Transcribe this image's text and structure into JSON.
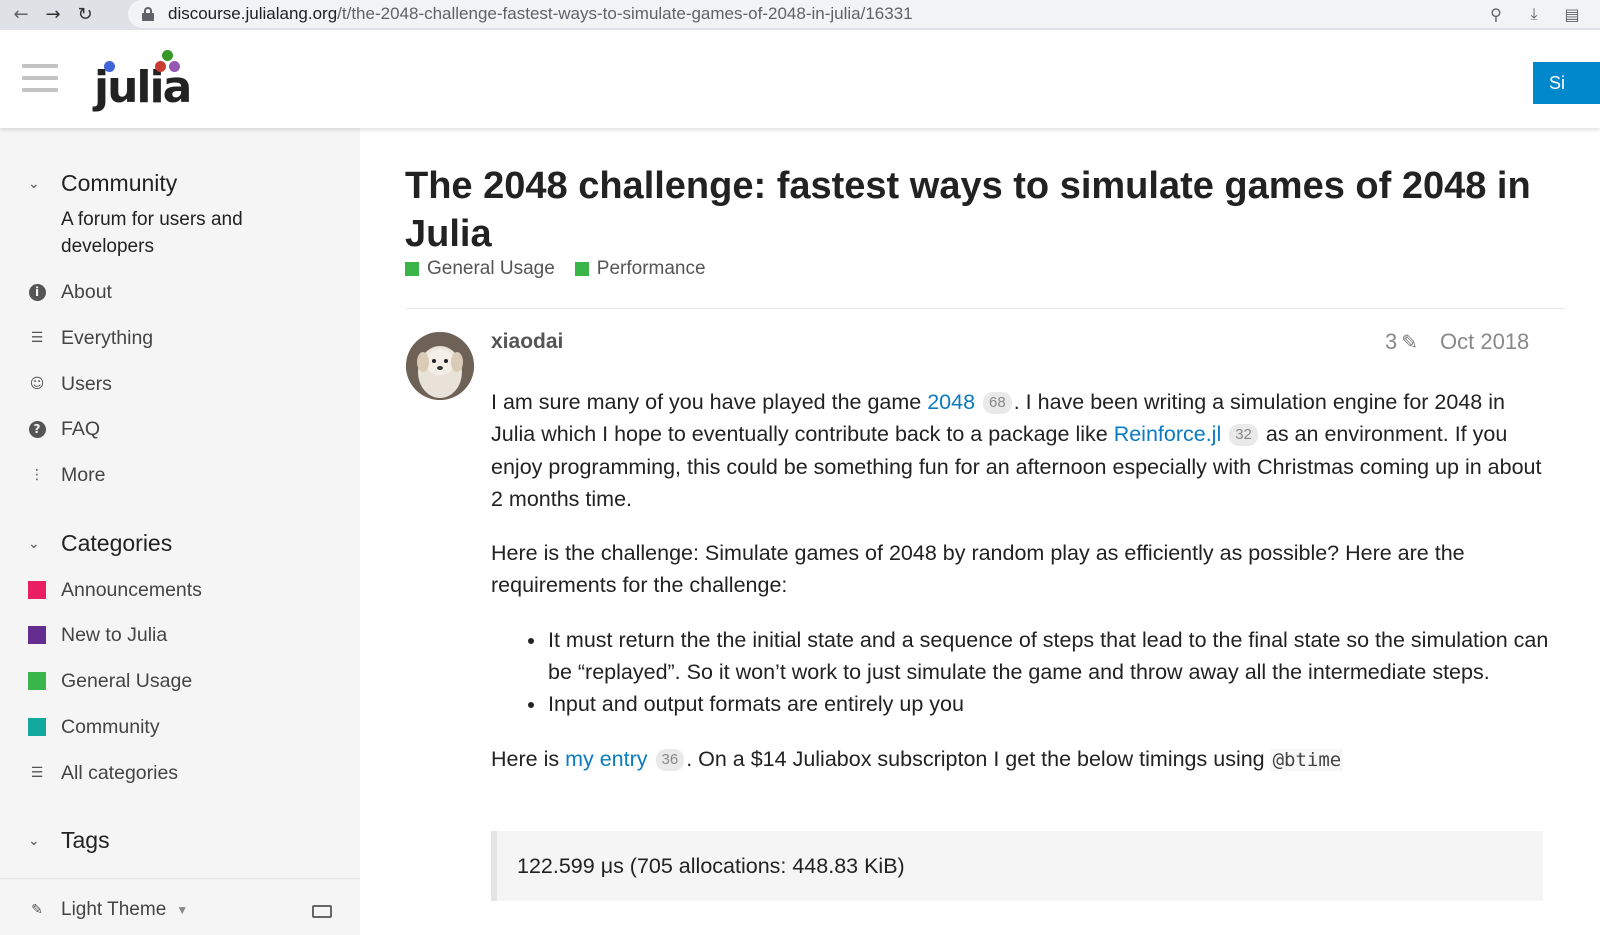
{
  "browser": {
    "domain": "discourse.julialang.org",
    "path": "/t/the-2048-challenge-fastest-ways-to-simulate-games-of-2048-in-julia/16331"
  },
  "header": {
    "logo_text": "julia",
    "signin_label": "Si",
    "accent": "#0088cc"
  },
  "sidebar": {
    "community": {
      "heading": "Community",
      "description": "A forum for users and developers",
      "items": [
        {
          "label": "About",
          "icon": "info-icon"
        },
        {
          "label": "Everything",
          "icon": "layers-icon"
        },
        {
          "label": "Users",
          "icon": "users-icon"
        },
        {
          "label": "FAQ",
          "icon": "question-icon"
        },
        {
          "label": "More",
          "icon": "ellipsis-vertical-icon"
        }
      ]
    },
    "categories": {
      "heading": "Categories",
      "items": [
        {
          "label": "Announcements",
          "color": "#e91e63"
        },
        {
          "label": "New to Julia",
          "color": "#652d90"
        },
        {
          "label": "General Usage",
          "color": "#3ab54a"
        },
        {
          "label": "Community",
          "color": "#12a89d"
        },
        {
          "label": "All categories",
          "icon": "list-icon"
        }
      ]
    },
    "tags": {
      "heading": "Tags"
    },
    "footer": {
      "theme_label": "Light Theme"
    }
  },
  "topic": {
    "title_line1": "The 2048 challenge: fastest ways to simulate games of 2048 in",
    "title_line2": "Julia",
    "categories": [
      {
        "label": "General Usage",
        "color": "#3ab54a"
      },
      {
        "label": "Performance",
        "color": "#3ab54a"
      }
    ]
  },
  "post": {
    "username": "xiaodai",
    "edit_count": "3",
    "date": "Oct 2018",
    "p1": {
      "t1": "I am sure many of you have played the game ",
      "link1": "2048",
      "count1": "68",
      "t2": ". I have been writing a simulation engine for 2048 in Julia which I hope to eventually contribute back to a package like ",
      "link2": "Reinforce.jl",
      "count2": "32",
      "t3": " as an environment. If you enjoy programming, this could be something fun for an afternoon especially with Christmas coming up in about 2 months time."
    },
    "p2": "Here is the challenge: Simulate games of 2048 by random play as efficiently as possible? Here are the requirements for the challenge:",
    "bullets": [
      "It must return the the initial state and a sequence of steps that lead to the final state so the simulation can be “replayed”. So it won’t work to just simulate the game and throw away all the intermediate steps.",
      "Input and output formats are entirely up you"
    ],
    "p3": {
      "t1": "Here is ",
      "link": "my entry",
      "count": "36",
      "t2": ". On a $14 Juliabox subscripton I get the below timings using ",
      "code": "@btime"
    },
    "quote": "122.599 μs (705 allocations: 448.83 KiB)"
  }
}
